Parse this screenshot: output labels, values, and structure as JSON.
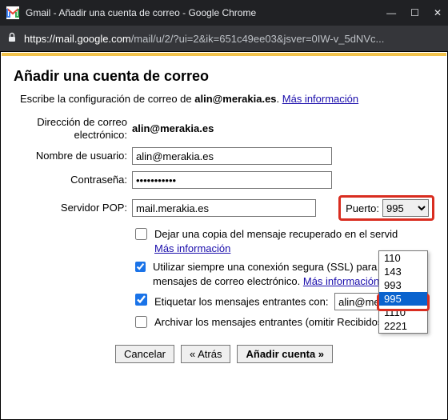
{
  "window": {
    "title": "Gmail - Añadir una cuenta de correo - Google Chrome"
  },
  "addressbar": {
    "domain": "https://mail.google.com",
    "path": "/mail/u/2/?ui=2&ik=651c49ee03&jsver=0IW-v_5dNVc..."
  },
  "heading": "Añadir una cuenta de correo",
  "subheading_prefix": "Escribe la configuración de correo de ",
  "subheading_email": "alin@merakia.es",
  "subheading_suffix": ". ",
  "more_info": "Más información",
  "labels": {
    "email_address": "Dirección de correo electrónico:",
    "username": "Nombre de usuario:",
    "password": "Contraseña:",
    "pop_server": "Servidor POP:",
    "port": "Puerto:"
  },
  "values": {
    "email_address": "alin@merakia.es",
    "username": "alin@merakia.es",
    "password": "•••••••••••",
    "pop_server": "mail.merakia.es",
    "port_selected": "995",
    "label_incoming_value": "alin@meraki"
  },
  "checkbox_labels": {
    "leave_copy": "Dejar una copia del mensaje recuperado en el servid",
    "ssl": "Utilizar siempre una conexión segura (SSL) para rec mensajes de correo electrónico. ",
    "label_incoming": "Etiquetar los mensajes entrantes con:",
    "archive": "Archivar los mensajes entrantes (omitir Recibidos)"
  },
  "checkbox_states": {
    "leave_copy": false,
    "ssl": true,
    "label_incoming": true,
    "archive": false
  },
  "buttons": {
    "cancel": "Cancelar",
    "back": "« Atrás",
    "add": "Añadir cuenta »"
  },
  "port_options": [
    "110",
    "143",
    "993",
    "995",
    "1110",
    "2221"
  ],
  "port_highlighted": "995"
}
